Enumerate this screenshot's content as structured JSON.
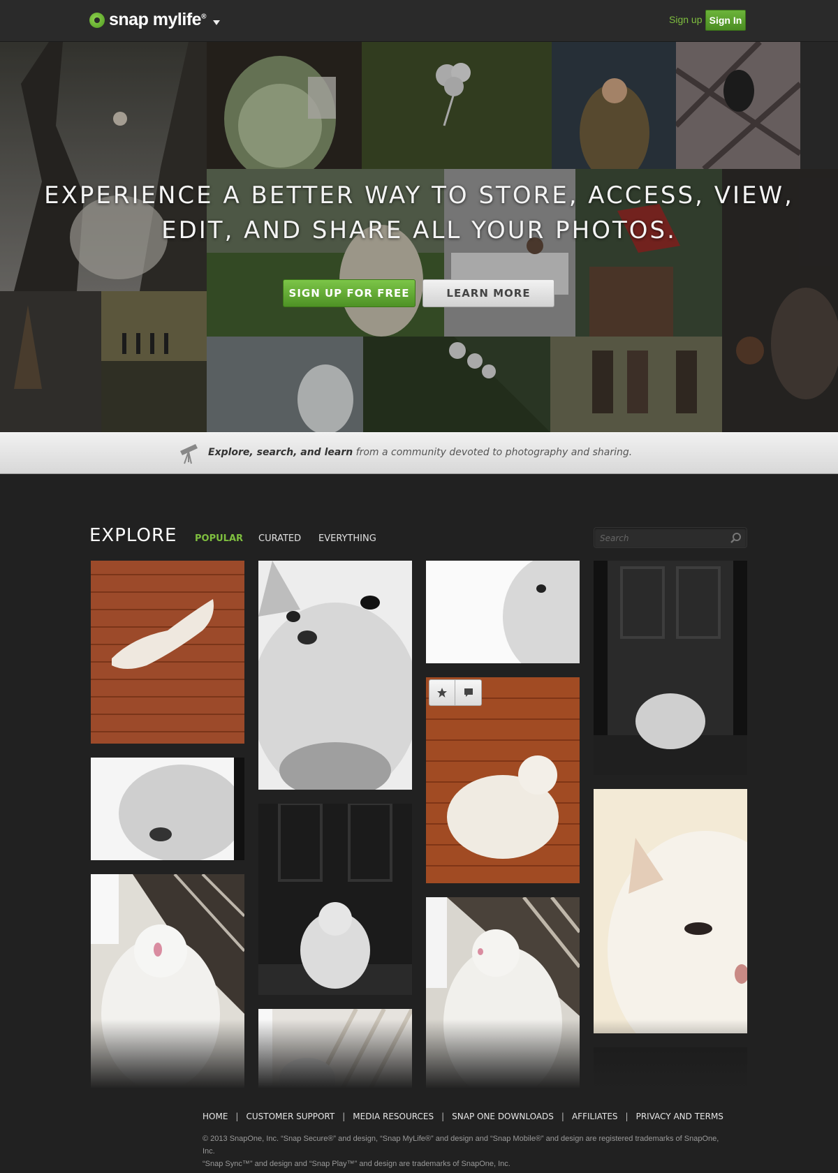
{
  "header": {
    "logo_text": "snap mylife",
    "logo_reg": "®",
    "signup_link": "Sign up",
    "signin_button": "Sign In"
  },
  "hero": {
    "headline_line1": "EXPERIENCE A BETTER WAY TO STORE, ACCESS, VIEW,",
    "headline_line2": "EDIT, AND SHARE ALL YOUR PHOTOS.",
    "signup_button": "SIGN UP FOR FREE",
    "learn_button": "LEARN MORE"
  },
  "banner": {
    "bold": "Explore, search, and learn",
    "rest": " from a community devoted to photography and sharing."
  },
  "explore": {
    "title": "EXPLORE",
    "tabs": [
      "POPULAR",
      "CURATED",
      "EVERYTHING"
    ],
    "active_tab": "POPULAR",
    "search_placeholder": "Search",
    "accent_color": "#7fbf3f"
  },
  "footer": {
    "links": [
      "HOME",
      "CUSTOMER SUPPORT",
      "MEDIA RESOURCES",
      "SNAP ONE DOWNLOADS",
      "AFFILIATES",
      "PRIVACY AND TERMS"
    ],
    "legal_line1": "© 2013 SnapOne, Inc. “Snap Secure®” and design, “Snap MyLife®” and design and “Snap Mobile®” and design are registered trademarks of SnapOne, Inc.",
    "legal_line2": "“Snap Sync™” and design and “Snap Play™” and design are trademarks of SnapOne, Inc."
  }
}
